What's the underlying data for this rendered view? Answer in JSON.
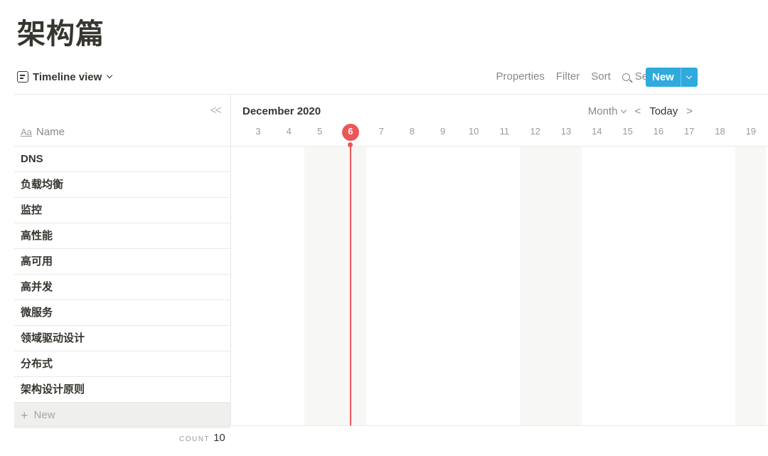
{
  "page": {
    "title": "架构篇"
  },
  "view": {
    "label": "Timeline view"
  },
  "toolbar": {
    "properties": "Properties",
    "filter": "Filter",
    "sort": "Sort",
    "search": "Search",
    "more": "•••",
    "new": "New",
    "accent_color": "#2eaadc"
  },
  "table": {
    "collapse": "<<",
    "name_icon": "Aa",
    "name_header": "Name",
    "rows": [
      "DNS",
      "负载均衡",
      "监控",
      "高性能",
      "高可用",
      "高并发",
      "微服务",
      "领域驱动设计",
      "分布式",
      "架构设计原则"
    ],
    "new_row": "New",
    "count_label": "COUNT",
    "count_value": "10"
  },
  "timeline": {
    "month_label": "December 2020",
    "scale": "Month",
    "prev": "<",
    "today": "Today",
    "next": ">",
    "days": [
      "3",
      "4",
      "5",
      "6",
      "7",
      "8",
      "9",
      "10",
      "11",
      "12",
      "13",
      "14",
      "15",
      "16",
      "17",
      "18",
      "19"
    ],
    "today_day": "6",
    "weekend_days": [
      "5",
      "6",
      "12",
      "13",
      "19"
    ],
    "today_color": "#eb5757"
  }
}
